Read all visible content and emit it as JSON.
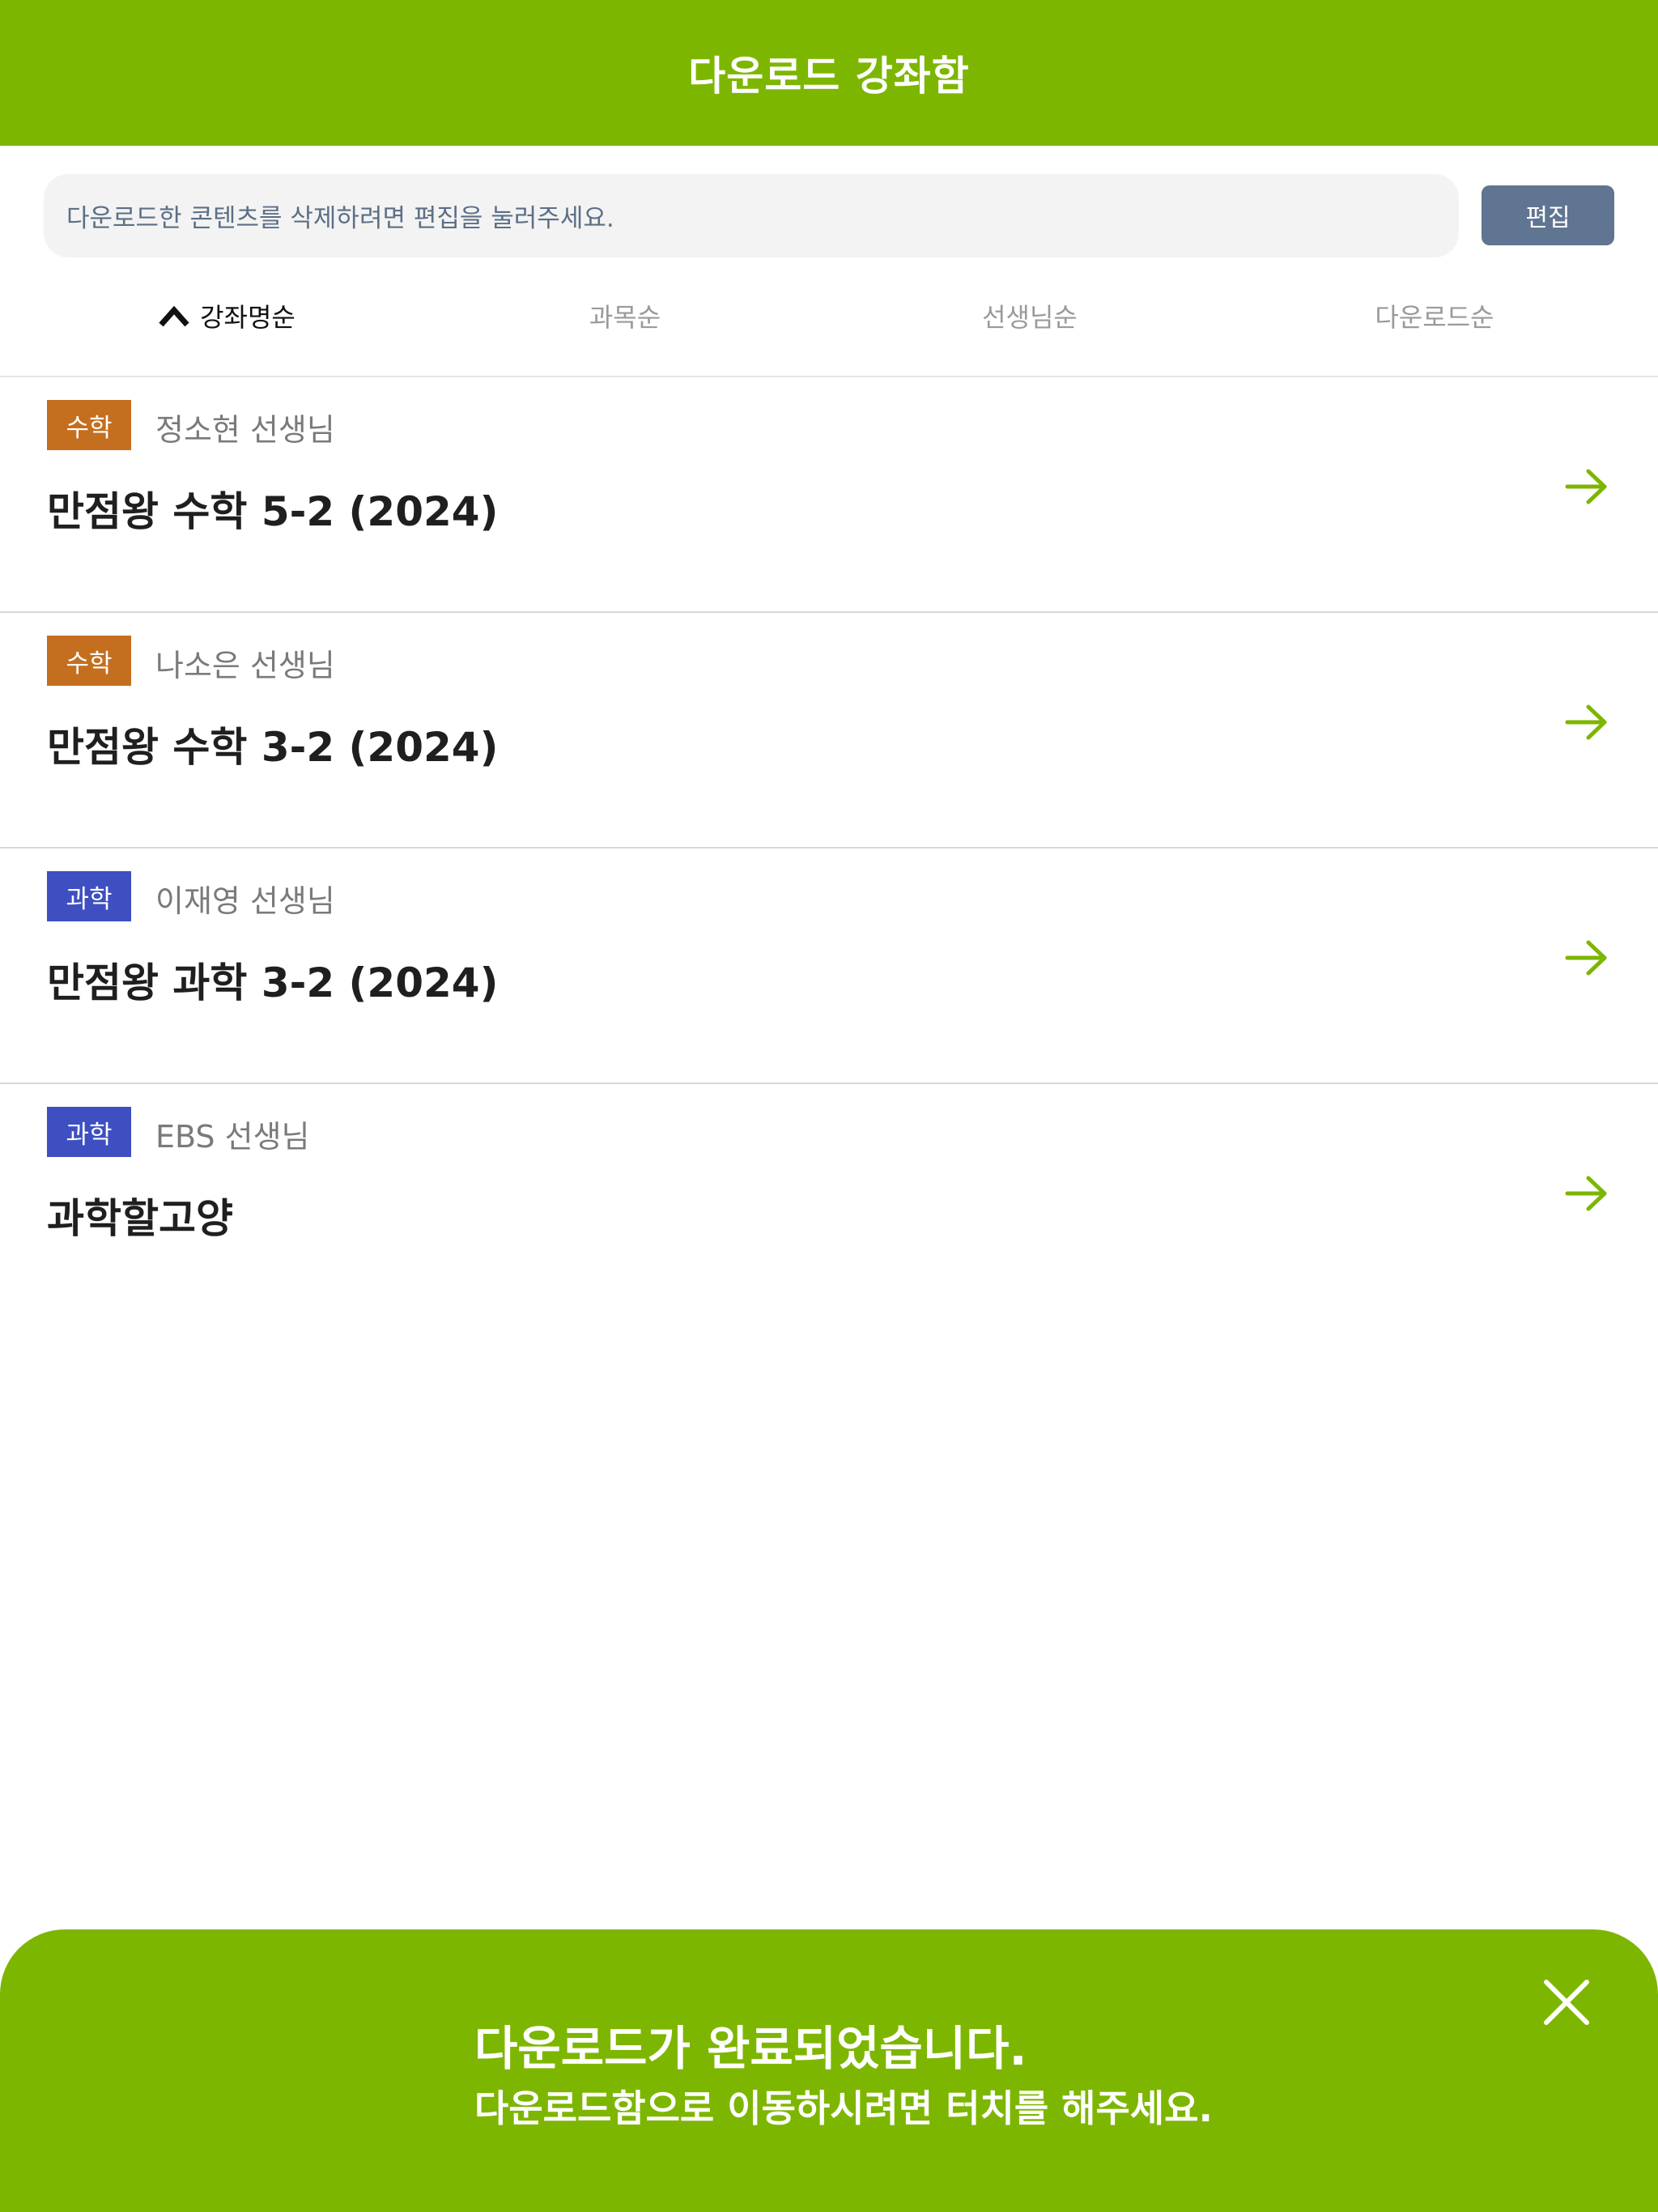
{
  "header": {
    "title": "다운로드 강좌함"
  },
  "notice": {
    "text": "다운로드한 콘텐츠를 삭제하려면 편집을 눌러주세요."
  },
  "edit_button": {
    "label": "편집"
  },
  "sort_tabs": [
    {
      "label": "강좌명순",
      "active": true
    },
    {
      "label": "과목순",
      "active": false
    },
    {
      "label": "선생님순",
      "active": false
    },
    {
      "label": "다운로드순",
      "active": false
    }
  ],
  "courses": [
    {
      "subject": "수학",
      "subject_color": "#c46f1f",
      "teacher": "정소현 선생님",
      "title": "만점왕 수학 5-2 (2024)"
    },
    {
      "subject": "수학",
      "subject_color": "#c46f1f",
      "teacher": "나소은 선생님",
      "title": "만점왕 수학 3-2 (2024)"
    },
    {
      "subject": "과학",
      "subject_color": "#3e4fc1",
      "teacher": "이재영 선생님",
      "title": "만점왕 과학 3-2 (2024)"
    },
    {
      "subject": "과학",
      "subject_color": "#3e4fc1",
      "teacher": "EBS 선생님",
      "title": "과학할고양"
    }
  ],
  "toast": {
    "line1": "다운로드가 완료되었습니다.",
    "line2": "다운로드함으로 이동하시려면 터치를 해주세요."
  },
  "colors": {
    "accent": "#7db600",
    "edit_button": "#5f7591",
    "math": "#c46f1f",
    "science": "#3e4fc1"
  },
  "icons": {
    "sort": "chevron-up-icon",
    "row": "arrow-right-icon",
    "close": "close-icon"
  }
}
